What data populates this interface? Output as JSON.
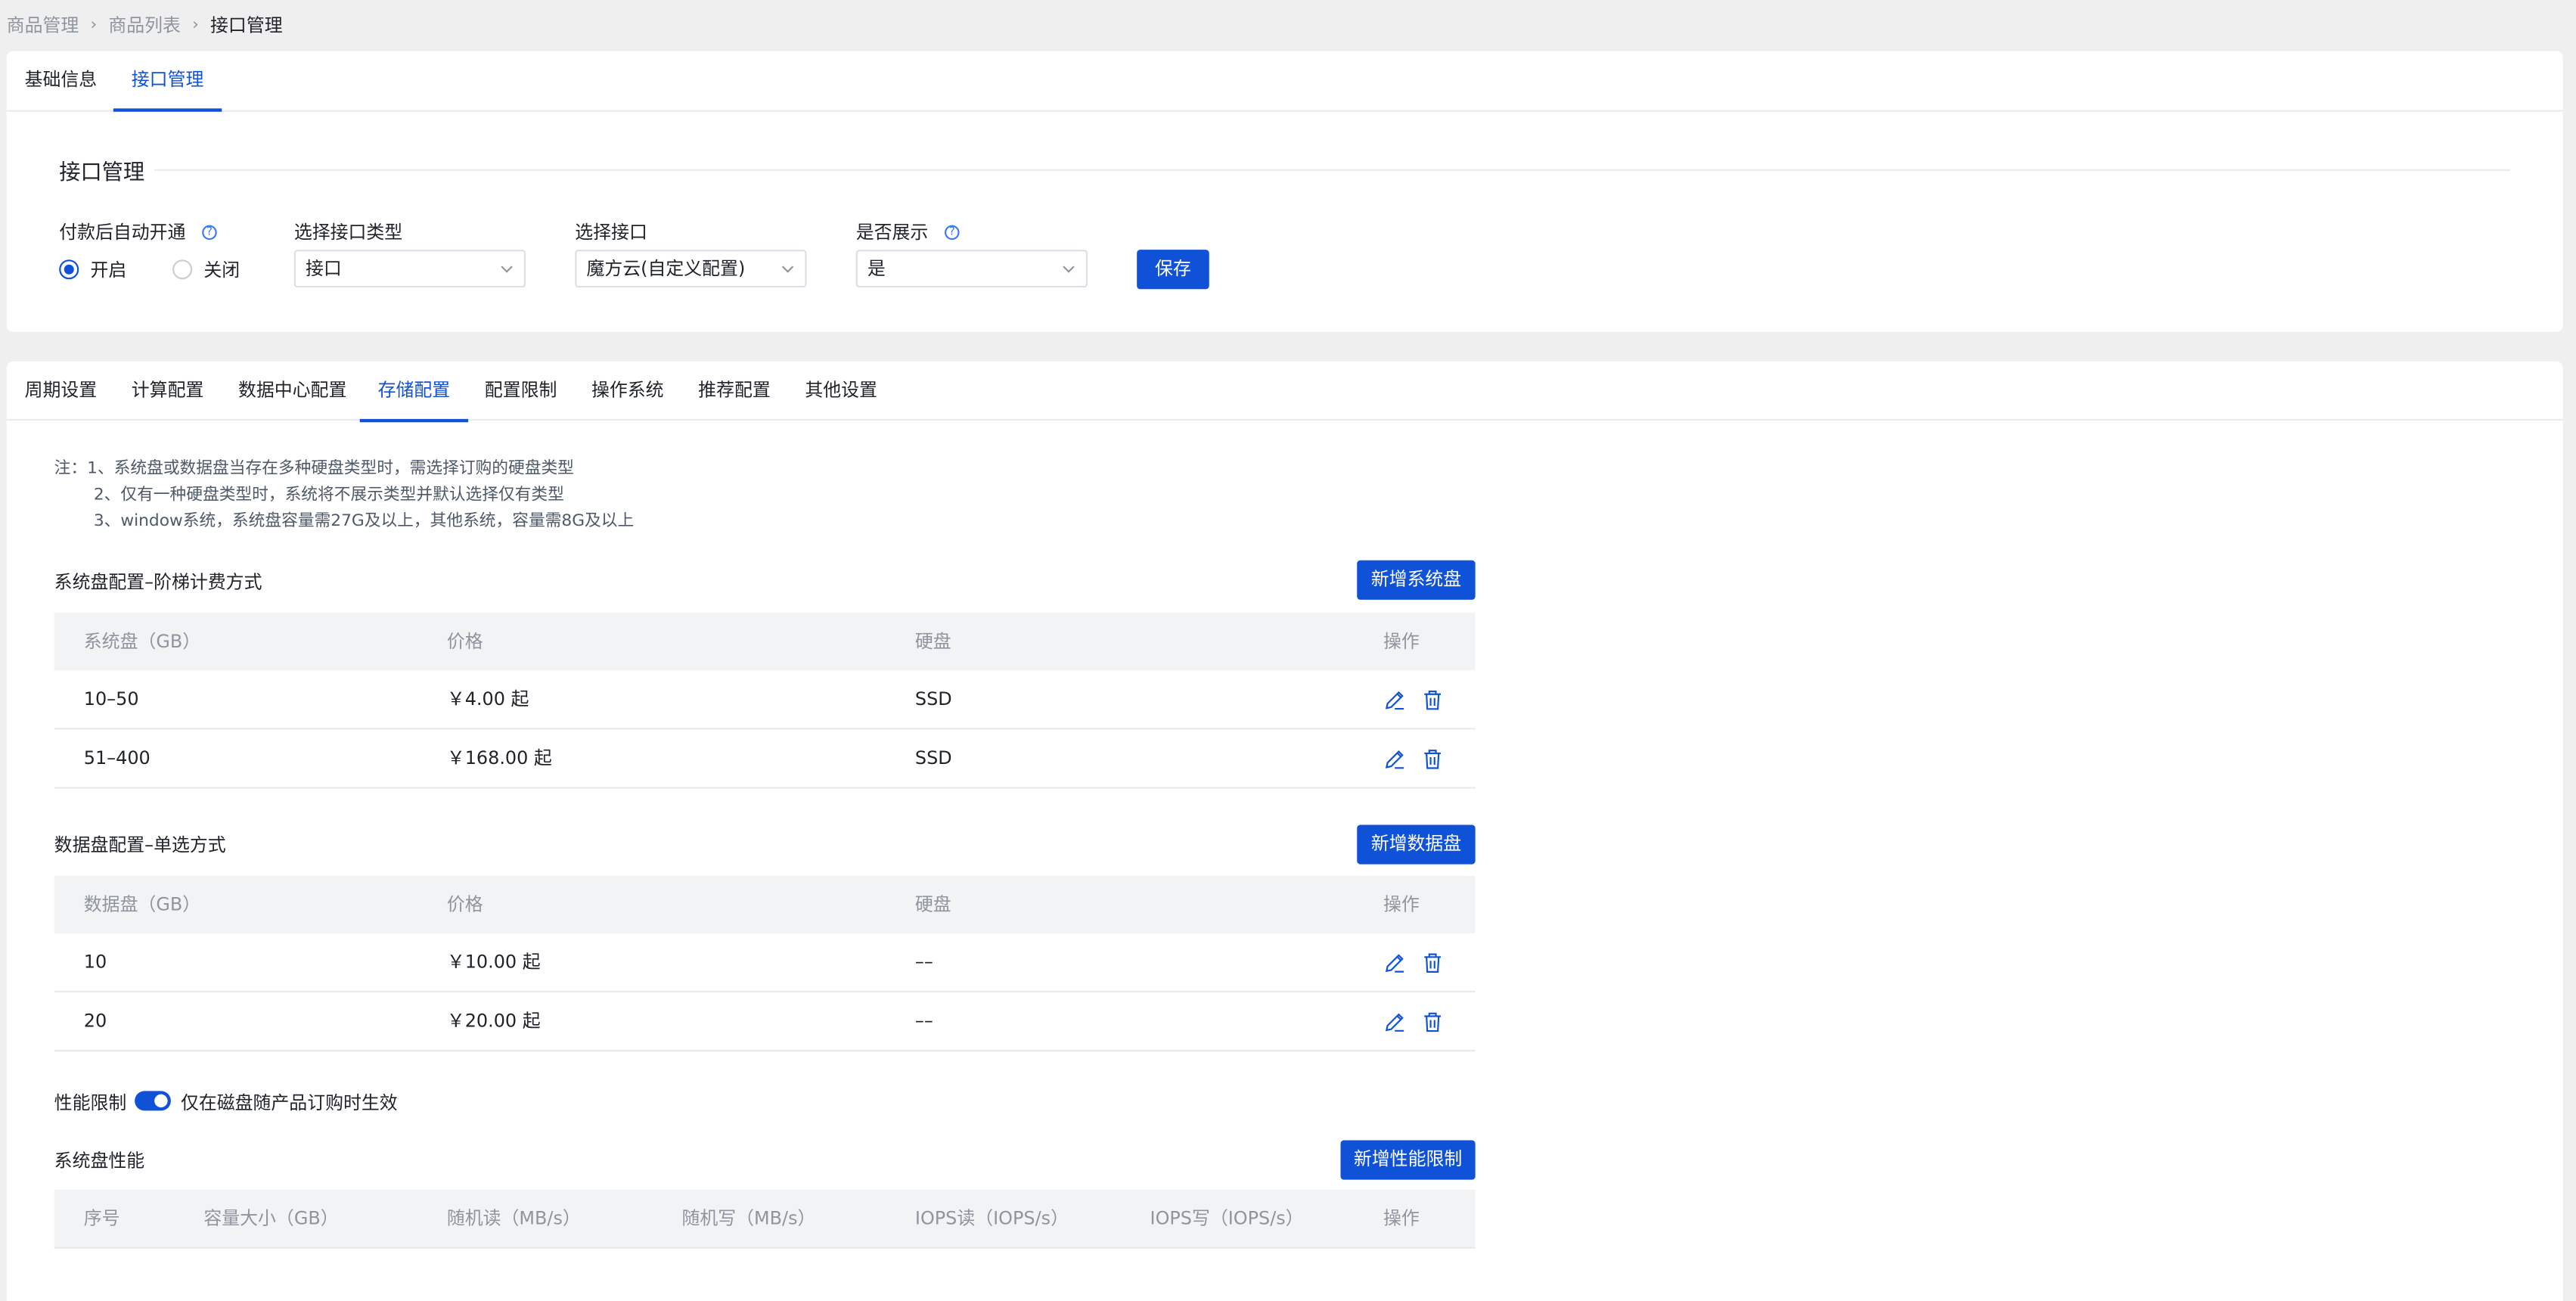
{
  "breadcrumb": {
    "items": [
      "商品管理",
      "商品列表",
      "接口管理"
    ],
    "separator": "›"
  },
  "top_tabs": [
    {
      "label": "基础信息"
    },
    {
      "label": "接口管理"
    }
  ],
  "interface_section": {
    "title": "接口管理",
    "auto_open": {
      "label": "付款后自动开通",
      "on_label": "开启",
      "off_label": "关闭",
      "selected": "开启"
    },
    "interface_type": {
      "label": "选择接口类型",
      "value": "接口"
    },
    "interface": {
      "label": "选择接口",
      "value": "魔方云(自定义配置)"
    },
    "display": {
      "label": "是否展示",
      "value": "是"
    },
    "save_label": "保存"
  },
  "config_tabs": [
    {
      "label": "周期设置"
    },
    {
      "label": "计算配置"
    },
    {
      "label": "数据中心配置"
    },
    {
      "label": "存储配置"
    },
    {
      "label": "配置限制"
    },
    {
      "label": "操作系统"
    },
    {
      "label": "推荐配置"
    },
    {
      "label": "其他设置"
    }
  ],
  "active_config_tab": "存储配置",
  "notes": [
    "注：1、系统盘或数据盘当存在多种硬盘类型时，需选择订购的硬盘类型",
    "2、仅有一种硬盘类型时，系统将不展示类型并默认选择仅有类型",
    "3、window系统，系统盘容量需27G及以上，其他系统，容量需8G及以上"
  ],
  "system_disk": {
    "title": "系统盘配置–阶梯计费方式",
    "add_label": "新增系统盘",
    "headers": [
      "系统盘（GB）",
      "价格",
      "硬盘",
      "操作"
    ],
    "rows": [
      {
        "size": "10–50",
        "price": "￥4.00 起",
        "disk": "SSD"
      },
      {
        "size": "51–400",
        "price": "￥168.00 起",
        "disk": "SSD"
      }
    ]
  },
  "data_disk": {
    "title": "数据盘配置–单选方式",
    "add_label": "新增数据盘",
    "headers": [
      "数据盘（GB）",
      "价格",
      "硬盘",
      "操作"
    ],
    "rows": [
      {
        "size": "10",
        "price": "￥10.00 起",
        "disk": "––"
      },
      {
        "size": "20",
        "price": "￥20.00 起",
        "disk": "––"
      }
    ]
  },
  "performance": {
    "label": "性能限制",
    "toggle_on": true,
    "toggle_label": "仅在磁盘随产品订购时生效",
    "system_title": "系统盘性能",
    "add_label": "新增性能限制",
    "headers": [
      "序号",
      "容量大小（GB）",
      "随机读（MB/s）",
      "随机写（MB/s）",
      "IOPS读（IOPS/s）",
      "IOPS写（IOPS/s）",
      "操作"
    ]
  },
  "colors": {
    "accent": "#0f52d8",
    "background": "#efefef"
  },
  "icons": {
    "edit": "edit-icon",
    "delete": "trash-icon",
    "help": "help-icon",
    "separator": "chevron-right-icon",
    "dropdown": "chevron-down-icon"
  }
}
